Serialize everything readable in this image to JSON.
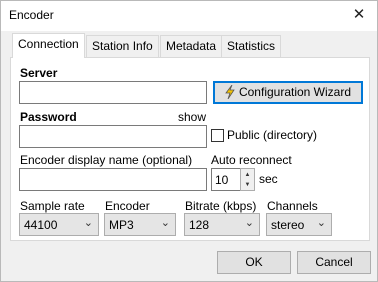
{
  "window": {
    "title": "Encoder",
    "close_glyph": "✕"
  },
  "tabs": [
    {
      "label": "Connection",
      "active": true
    },
    {
      "label": "Station Info",
      "active": false
    },
    {
      "label": "Metadata",
      "active": false
    },
    {
      "label": "Statistics",
      "active": false
    }
  ],
  "connection": {
    "server_label": "Server",
    "server_value": "",
    "wizard_button": "Configuration Wizard",
    "wizard_icon": "lightning-icon",
    "password_label": "Password",
    "show_label": "show",
    "password_value": "",
    "public_label": "Public (directory)",
    "public_checked": false,
    "display_name_label": "Encoder display name (optional)",
    "display_name_value": "",
    "auto_reconnect_label": "Auto reconnect",
    "auto_reconnect_value": "10",
    "auto_reconnect_unit": "sec",
    "sample_rate_label": "Sample rate",
    "sample_rate_value": "44100",
    "encoder_label": "Encoder",
    "encoder_value": "MP3",
    "bitrate_label": "Bitrate (kbps)",
    "bitrate_value": "128",
    "channels_label": "Channels",
    "channels_value": "stereo"
  },
  "footer": {
    "ok": "OK",
    "cancel": "Cancel"
  }
}
